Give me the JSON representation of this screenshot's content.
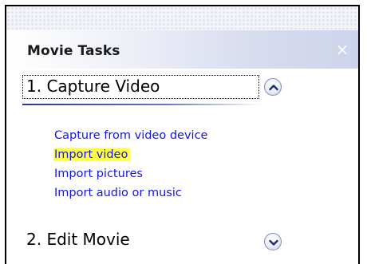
{
  "pane": {
    "title": "Movie Tasks",
    "close_glyph": "×",
    "colors": {
      "border": "#000000",
      "link": "#1515e0",
      "highlight": "#ffff44"
    }
  },
  "sections": [
    {
      "title": "1. Capture Video",
      "state": "expanded",
      "toggle_icon": "chevron-up-icon",
      "items": [
        {
          "label": "Capture from video device",
          "highlighted": false
        },
        {
          "label": "Import video",
          "highlighted": true
        },
        {
          "label": "Import pictures",
          "highlighted": false
        },
        {
          "label": "Import audio or music",
          "highlighted": false
        }
      ]
    },
    {
      "title": "2. Edit Movie",
      "state": "collapsed",
      "toggle_icon": "chevron-down-icon"
    }
  ]
}
